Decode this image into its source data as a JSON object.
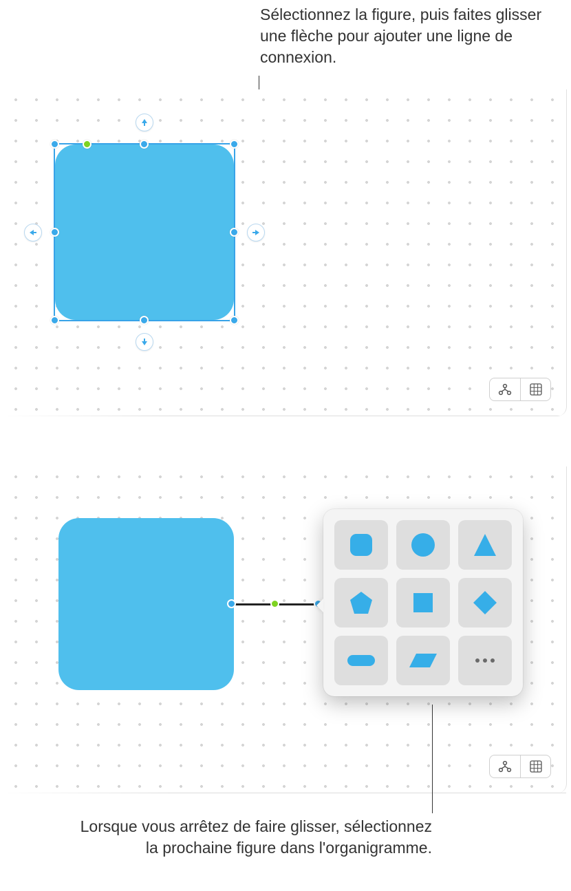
{
  "callouts": {
    "top": "Sélectionnez la figure, puis faites glisser une flèche pour ajouter une ligne de connexion.",
    "bottom": "Lorsque vous arrêtez de faire glisser, sélectionnez la prochaine figure dans l'organigramme."
  },
  "canvas1": {
    "shape_name": "rounded-rectangle",
    "shape_color": "#4fbfed",
    "selected": true,
    "connection_arrows": [
      "up",
      "down",
      "left",
      "right"
    ],
    "toolbar_icons": [
      "diagram-icon",
      "grid-icon"
    ]
  },
  "canvas2": {
    "shape_name": "rounded-rectangle",
    "shape_color": "#4fbfed",
    "connector_line": true,
    "toolbar_icons": [
      "diagram-icon",
      "grid-icon"
    ],
    "shape_picker": [
      "rounded-square",
      "circle",
      "triangle",
      "pentagon",
      "square",
      "diamond",
      "rounded-pill",
      "parallelogram",
      "more"
    ]
  },
  "language": "fr"
}
